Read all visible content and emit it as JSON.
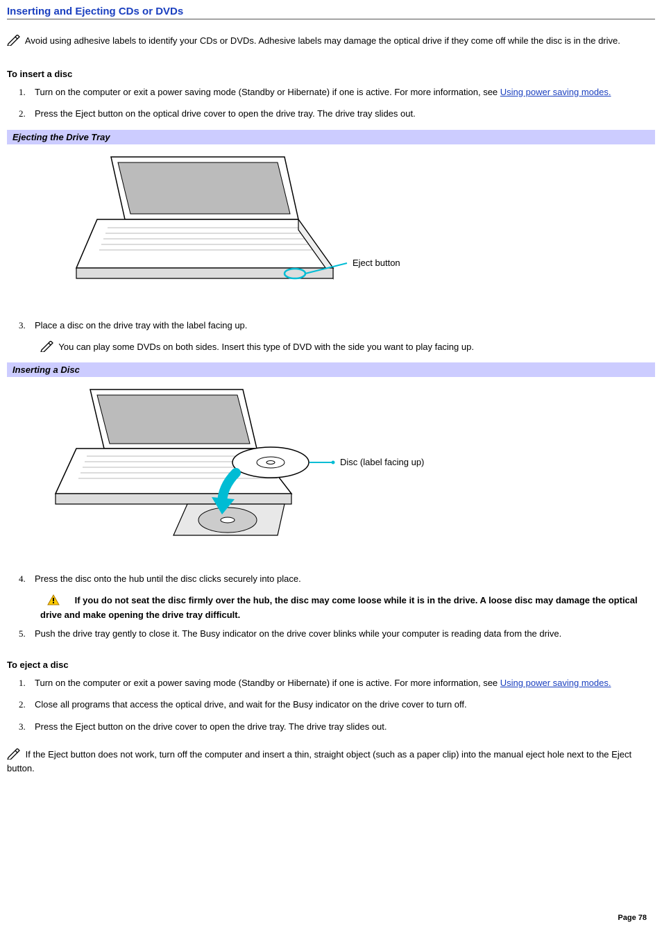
{
  "title": "Inserting and Ejecting CDs or DVDs",
  "topNote": "Avoid using adhesive labels to identify your CDs or DVDs. Adhesive labels may damage the optical drive if they come off while the disc is in the drive.",
  "insert": {
    "heading": "To insert a disc",
    "step1a": "Turn on the computer or exit a power saving mode (Standby or Hibernate) if one is active. For more information, see ",
    "step1link": "Using power saving modes.",
    "step2": "Press the Eject button on the optical drive cover to open the drive tray. The drive tray slides out.",
    "fig1Caption": "Ejecting the Drive Tray",
    "fig1Label": "Eject button",
    "step3": "Place a disc on the drive tray with the label facing up.",
    "step3note": "You can play some DVDs on both sides. Insert this type of DVD with the side you want to play facing up.",
    "fig2Caption": "Inserting a Disc",
    "fig2Label": "Disc (label facing up)",
    "step4": "Press the disc onto the hub until the disc clicks securely into place.",
    "step4warn": "If you do not seat the disc firmly over the hub, the disc may come loose while it is in the drive. A loose disc may damage the optical drive and make opening the drive tray difficult.",
    "step5": "Push the drive tray gently to close it. The Busy indicator on the drive cover blinks while your computer is reading data from the drive."
  },
  "eject": {
    "heading": "To eject a disc",
    "step1a": "Turn on the computer or exit a power saving mode (Standby or Hibernate) if one is active. For more information, see ",
    "step1link": "Using power saving modes.",
    "step2": "Close all programs that access the optical drive, and wait for the Busy indicator on the drive cover to turn off.",
    "step3": "Press the Eject button on the drive cover to open the drive tray. The drive tray slides out."
  },
  "bottomNote": "If the Eject button does not work, turn off the computer and insert a thin, straight object (such as a paper clip) into the manual eject hole next to the Eject button.",
  "pageNum": "Page 78"
}
